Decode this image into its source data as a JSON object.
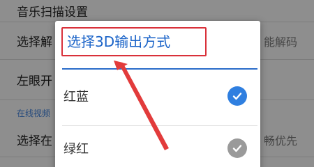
{
  "background": {
    "rows": [
      {
        "label": "音乐扫描设置",
        "right": ""
      },
      {
        "label": "选择解",
        "right": "能解码"
      },
      {
        "label": "左眼开",
        "right": ""
      },
      {
        "label": "选择在",
        "right": "畅优先"
      }
    ],
    "section_label": "在线视频"
  },
  "dialog": {
    "title": "选择3D输出方式",
    "options": [
      {
        "label": "红蓝",
        "selected": true
      },
      {
        "label": "绿红",
        "selected": false
      }
    ]
  },
  "colors": {
    "accent": "#2a6cc9",
    "highlight": "#d9313a",
    "check_selected": "#2f7fe0",
    "check_unselected": "#9a9a9a"
  }
}
